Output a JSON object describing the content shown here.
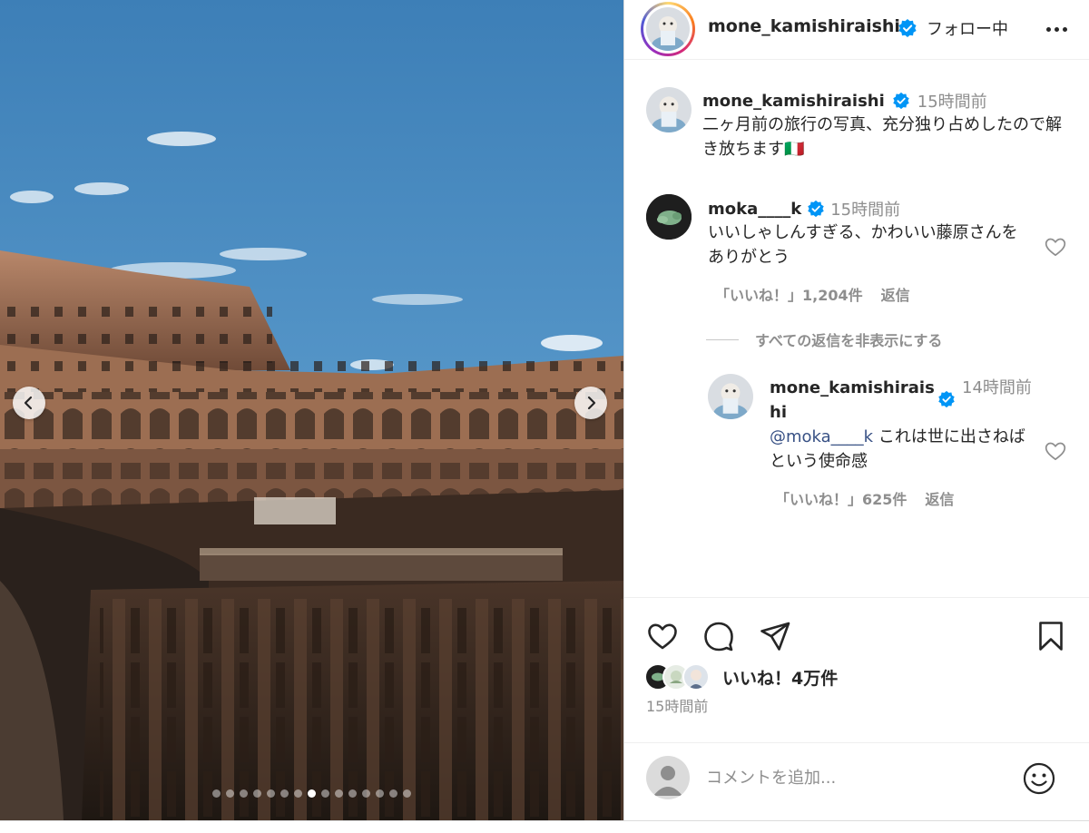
{
  "post": {
    "username": "mone_kamishiraishi",
    "follow_status": "フォロー中",
    "carousel": {
      "total_slides": 15,
      "active_slide": 8
    }
  },
  "caption": {
    "username": "mone_kamishiraishi",
    "time": "15時間前",
    "text": "二ヶ月前の旅行の写真、充分独り占めしたので解き放ちます🇮🇹"
  },
  "comment": {
    "username": "moka____k",
    "time": "15時間前",
    "text": "いいしゃしんすぎる、かわいい藤原さんをありがとう",
    "likes": "「いいね！」1,204件",
    "reply_label": "返信",
    "hide_replies": "すべての返信を非表示にする"
  },
  "reply": {
    "username": "mone_kamishiraishi",
    "time": "14時間前",
    "mention": "@moka____k",
    "text": "これは世に出さねばという使命感",
    "likes": "「いいね！」625件",
    "reply_label": "返信"
  },
  "actions": {
    "likes_total": "いいね！4万件",
    "posted": "15時間前"
  },
  "comment_box": {
    "placeholder": "コメントを追加..."
  },
  "colors": {
    "verified": "#0095f6",
    "secondary_text": "#8e8e8e",
    "mention": "#385185"
  },
  "icons": [
    "chevron-left-icon",
    "chevron-right-icon",
    "verified-badge-icon",
    "more-icon",
    "heart-icon",
    "comment-icon",
    "share-icon",
    "bookmark-icon",
    "emoji-icon"
  ]
}
